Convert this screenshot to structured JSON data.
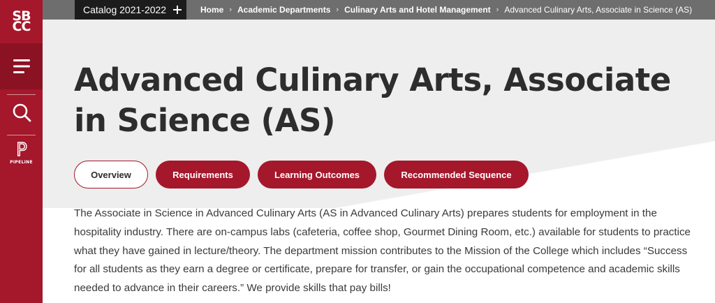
{
  "sidebar": {
    "logo_line1": "SB",
    "logo_line2": "CC",
    "menu_icon": "hamburger-menu-icon",
    "search_icon": "search-icon",
    "pipeline_letter": "P",
    "pipeline_label": "PIPELINE"
  },
  "topbar": {
    "catalog_label": "Catalog 2021-2022",
    "catalog_icon": "plus-icon",
    "breadcrumb": [
      {
        "label": "Home"
      },
      {
        "label": "Academic Departments"
      },
      {
        "label": "Culinary Arts and Hotel Management"
      }
    ],
    "breadcrumb_current": "Advanced Culinary Arts, Associate in Science (AS)"
  },
  "page": {
    "title": "Advanced Culinary Arts, Associate in Science (AS)",
    "tabs": [
      {
        "label": "Overview"
      },
      {
        "label": "Requirements"
      },
      {
        "label": "Learning Outcomes"
      },
      {
        "label": "Recommended Sequence"
      }
    ],
    "description": "The Associate in Science in Advanced Culinary Arts (AS in Advanced Culinary Arts) prepares students for employment in the hospitality industry. There are on-campus labs (cafeteria, coffee shop, Gourmet Dining Room, etc.) available for students to practice what they have gained in lecture/theory. The department mission contributes to the Mission of the College which includes “Success for all students as they earn a degree or certificate, prepare for transfer, or gain the occupational competence and academic skills needed to advance in their careers.” We provide skills that pay bills!"
  },
  "colors": {
    "brand_red": "#a5172b",
    "topbar_grey": "#6e6e6e",
    "catalog_black": "#1c1c1c"
  }
}
